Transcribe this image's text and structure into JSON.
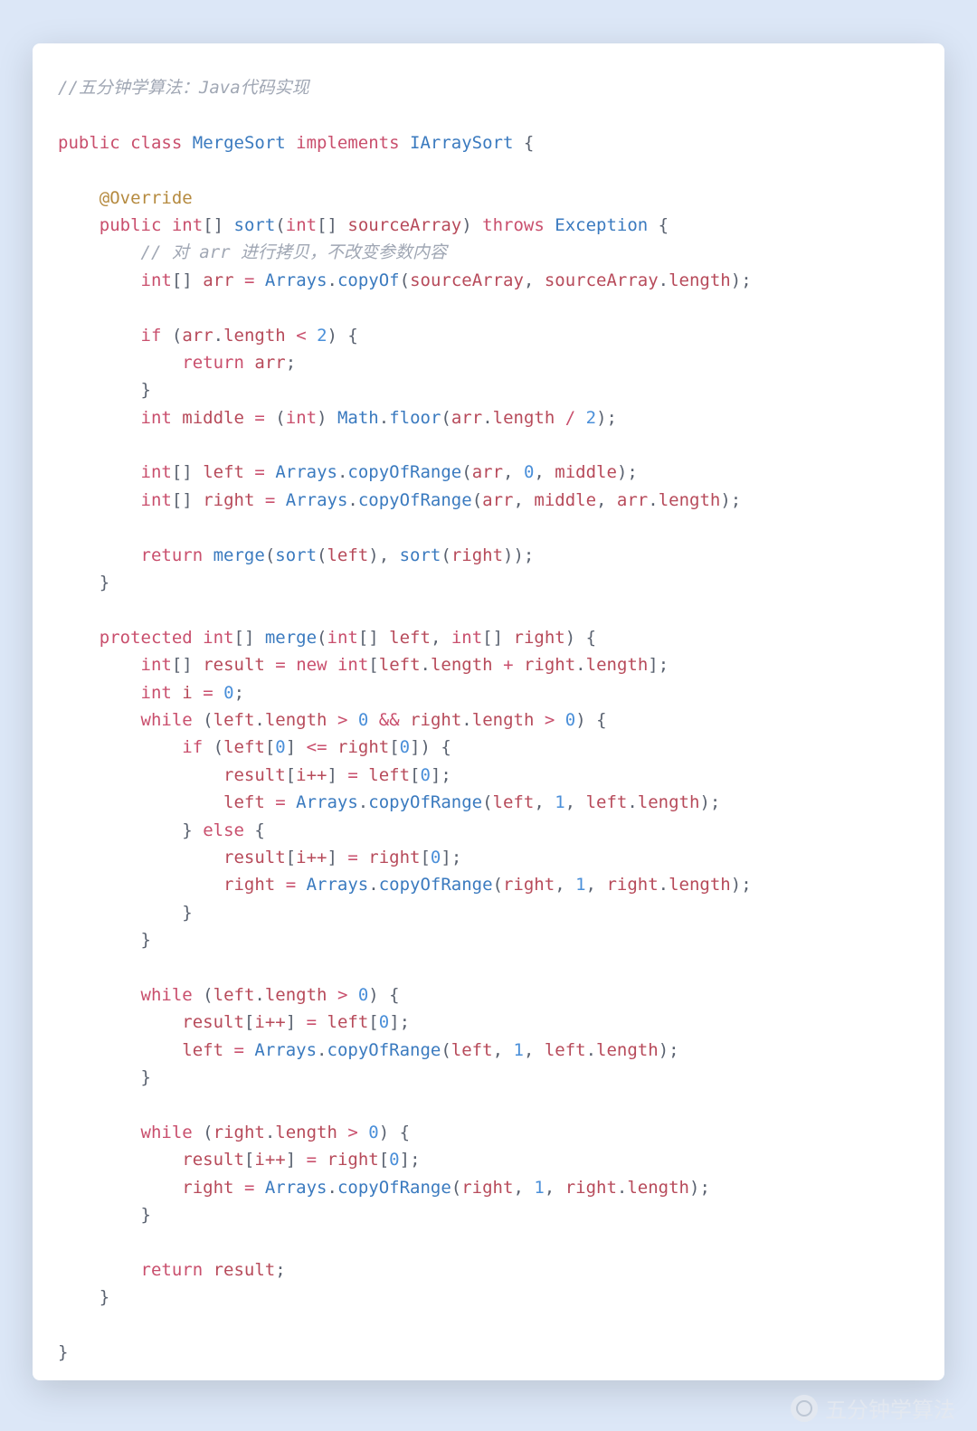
{
  "watermark": {
    "text": "五分钟学算法"
  },
  "code": {
    "comment_header": "//五分钟学算法：Java代码实现",
    "line_class_decl_public": "public",
    "line_class_decl_class": "class",
    "line_class_decl_name": "MergeSort",
    "line_class_decl_implements": "implements",
    "line_class_decl_iface": "IArraySort",
    "annotation_override": "@Override",
    "sort_sig_public": "public",
    "sort_sig_int": "int",
    "sort_sig_name": "sort",
    "sort_sig_param_type": "int",
    "sort_sig_param_name": "sourceArray",
    "sort_sig_throws": "throws",
    "sort_sig_exc": "Exception",
    "sort_comment": "// 对 arr 进行拷贝，不改变参数内容",
    "arr_decl_int": "int",
    "arr_decl_name": "arr",
    "arrays_cls": "Arrays",
    "copyOf": "copyOf",
    "sourceArray": "sourceArray",
    "length": "length",
    "if_kw": "if",
    "arr": "arr",
    "lt": "<",
    "two": "2",
    "return_kw": "return",
    "int_kw": "int",
    "middle": "middle",
    "math_cls": "Math",
    "floor": "floor",
    "div": "/",
    "left": "left",
    "right": "right",
    "copyOfRange": "copyOfRange",
    "zero": "0",
    "merge": "merge",
    "sort": "sort",
    "protected_kw": "protected",
    "merge_name": "merge",
    "result": "result",
    "new_kw": "new",
    "plus": "+",
    "i_var": "i",
    "eq": "=",
    "while_kw": "while",
    "gt": ">",
    "andand": "&&",
    "lte": "<=",
    "ipp": "i++",
    "else_kw": "else",
    "one": "1"
  }
}
